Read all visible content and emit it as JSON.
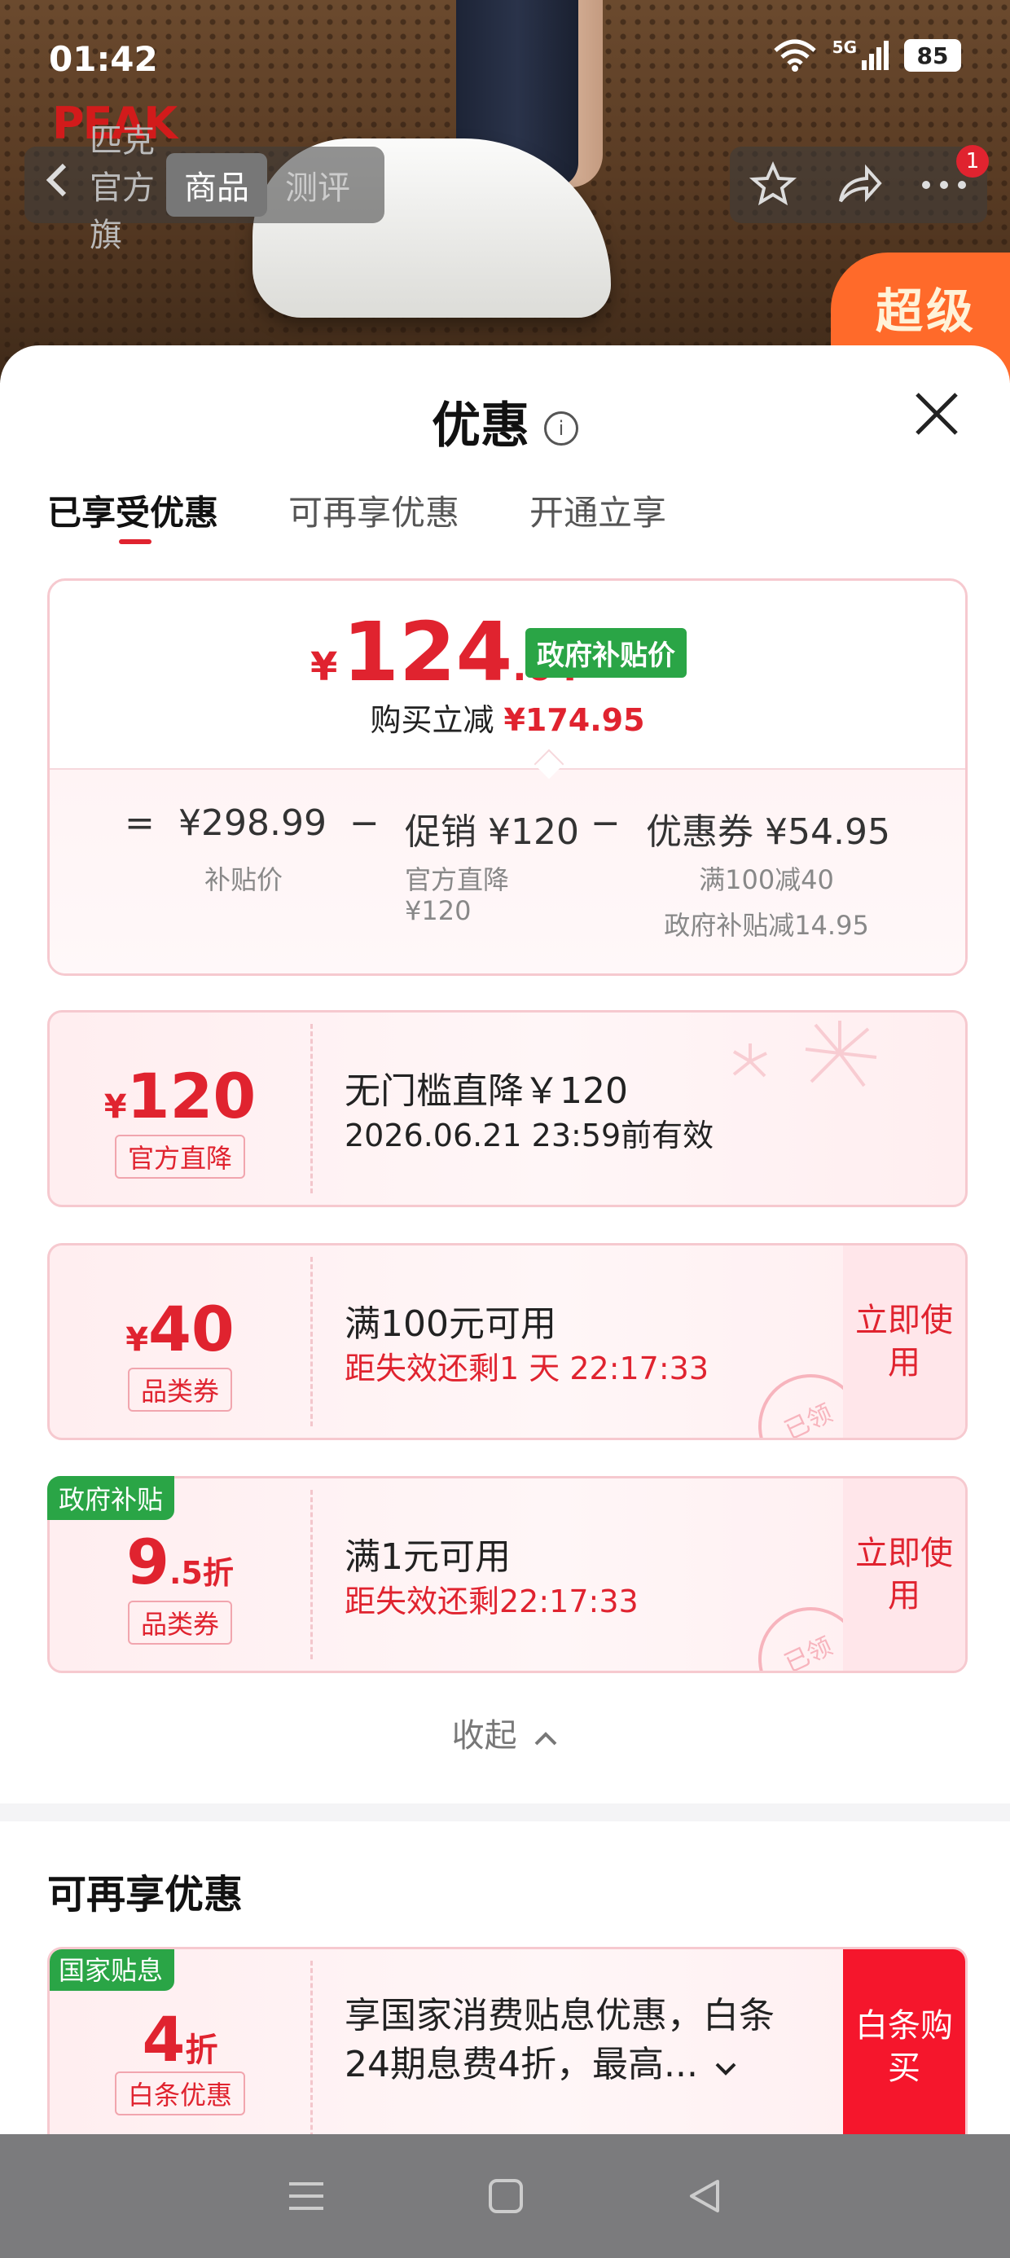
{
  "status_bar": {
    "time": "01:42",
    "network": "5G",
    "battery": "85"
  },
  "hero": {
    "brand_logo": "PEAK",
    "store_short": "匹克官方旗",
    "banner_text": "超级",
    "nav": {
      "back_icon": "chevron-left-icon",
      "tabs": [
        "商品",
        "测评"
      ],
      "active_tab": "商品"
    },
    "actions": {
      "notification_count": "1"
    }
  },
  "sheet": {
    "title": "优惠",
    "tabs": [
      "已享受优惠",
      "可再享优惠",
      "开通立享"
    ],
    "active_tab": "已享受优惠",
    "summary": {
      "currency": "¥",
      "price_int": "124",
      "price_dec": ".04",
      "price_badge": "政府补贴价",
      "reduce_label": "购买立减",
      "reduce_value": "¥174.95",
      "calc": {
        "equals": "=",
        "base_value": "¥298.99",
        "base_label": "补贴价",
        "minus": "−",
        "promo_value": "促销 ¥120",
        "promo_sub1": "官方直降",
        "promo_sub2": "¥120",
        "coupon_value": "优惠券 ¥54.95",
        "coupon_sub1": "满100减40",
        "coupon_sub2": "政府补贴减14.95"
      }
    },
    "coupons": [
      {
        "yen": "¥",
        "amount": "120",
        "suffix": "",
        "tag": "官方直降",
        "title": "无门槛直降￥120",
        "subtitle": "2026.06.21 23:59前有效",
        "action": "",
        "badge": ""
      },
      {
        "yen": "¥",
        "amount": "40",
        "suffix": "",
        "tag": "品类券",
        "title": "满100元可用",
        "subtitle": "距失效还剩1 天 22:17:33",
        "action": "立即使用",
        "badge": ""
      },
      {
        "yen": "",
        "amount": "9",
        "suffix": ".5折",
        "tag": "品类券",
        "title": "满1元可用",
        "subtitle": "距失效还剩22:17:33",
        "action": "立即使用",
        "badge": "政府补贴"
      }
    ],
    "stamp_text": "已领",
    "collapse_label": "收起",
    "more_section": {
      "title": "可再享优惠",
      "card": {
        "badge": "国家贴息",
        "amount": "4",
        "suffix": "折",
        "tag": "白条优惠",
        "desc": "享国家消费贴息优惠，白条24期息费4折，最高...",
        "action": "白条购买"
      }
    }
  },
  "nav_bar": {
    "icons": [
      "menu-icon",
      "home-square-icon",
      "back-triangle-icon"
    ]
  },
  "colors": {
    "accent_red": "#e0232f",
    "gov_green": "#2aa546",
    "buy_red": "#f5162c"
  }
}
